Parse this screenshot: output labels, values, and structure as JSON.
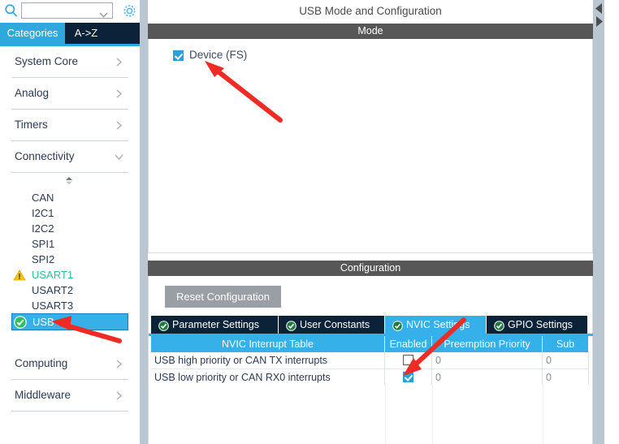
{
  "sidebar": {
    "search": {
      "value": "",
      "placeholder": "",
      "icon": "search-icon"
    },
    "dropdown_icon": "chevron-down-icon",
    "gear_icon": "gear-icon",
    "tabs": [
      {
        "label": "Categories",
        "active": true
      },
      {
        "label": "A->Z",
        "active": false
      }
    ],
    "categories": [
      {
        "label": "System Core",
        "chevron": "chevron-right-icon",
        "expanded": false
      },
      {
        "label": "Analog",
        "chevron": "chevron-right-icon",
        "expanded": false
      },
      {
        "label": "Timers",
        "chevron": "chevron-right-icon",
        "expanded": false
      },
      {
        "label": "Connectivity",
        "chevron": "chevron-down-icon",
        "expanded": true
      }
    ],
    "peripherals": [
      {
        "label": "CAN",
        "state": "none",
        "selected": false
      },
      {
        "label": "I2C1",
        "state": "none",
        "selected": false
      },
      {
        "label": "I2C2",
        "state": "none",
        "selected": false
      },
      {
        "label": "SPI1",
        "state": "none",
        "selected": false
      },
      {
        "label": "SPI2",
        "state": "none",
        "selected": false
      },
      {
        "label": "USART1",
        "state": "warning",
        "selected": false
      },
      {
        "label": "USART2",
        "state": "none",
        "selected": false
      },
      {
        "label": "USART3",
        "state": "none",
        "selected": false
      },
      {
        "label": "USB",
        "state": "ok",
        "selected": true
      }
    ],
    "categories_bottom": [
      {
        "label": "Computing",
        "chevron": "chevron-right-icon",
        "expanded": false
      },
      {
        "label": "Middleware",
        "chevron": "chevron-right-icon",
        "expanded": false
      }
    ],
    "scroll_up_icon": "scroll-up-indicator-icon"
  },
  "main": {
    "title": "USB Mode and Configuration",
    "mode": {
      "header": "Mode",
      "options": [
        {
          "label": "Device (FS)",
          "checked": true
        }
      ]
    },
    "configuration": {
      "header": "Configuration",
      "reset_button": "Reset Configuration",
      "tabs": [
        {
          "label": "Parameter Settings",
          "active": false,
          "icon": "check-circle-icon"
        },
        {
          "label": "User Constants",
          "active": false,
          "icon": "check-circle-icon"
        },
        {
          "label": "NVIC Settings",
          "active": true,
          "icon": "check-circle-icon"
        },
        {
          "label": "GPIO Settings",
          "active": false,
          "icon": "check-circle-icon"
        }
      ],
      "nvic_table": {
        "columns": [
          "NVIC Interrupt Table",
          "Enabled",
          "Preemption Priority",
          "Sub Priority"
        ],
        "rows": [
          {
            "interrupt": "USB high priority or CAN TX interrupts",
            "enabled": false,
            "preemption_priority": "0",
            "sub_priority": "0"
          },
          {
            "interrupt": "USB low priority or CAN RX0 interrupts",
            "enabled": true,
            "preemption_priority": "0",
            "sub_priority": "0"
          }
        ]
      }
    },
    "collapse_left_icon": "triangle-left-icon",
    "collapse_right_icon": "triangle-right-icon"
  },
  "annotations": [
    {
      "name": "arrow-to-device-checkbox",
      "color": "#ee2b24"
    },
    {
      "name": "arrow-to-usb-item",
      "color": "#ee2b24"
    },
    {
      "name": "arrow-to-nvic-enabled-checkbox",
      "color": "#ee2b24"
    }
  ],
  "colors": {
    "accent_cyan": "#35b0e8",
    "tab_navy": "#0b2239",
    "section_gray": "#575757",
    "ok_green": "#2fbf8f",
    "warn_yellow": "#f5c518",
    "annotation_red": "#ee2b24"
  }
}
